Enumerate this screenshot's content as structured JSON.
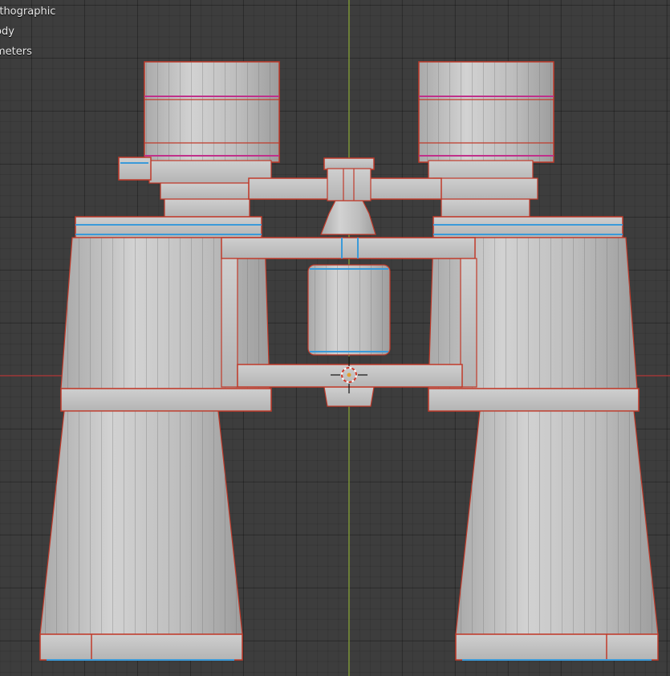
{
  "viewport": {
    "overlay_lines": [
      "rthographic",
      "ody",
      "meters"
    ],
    "colors": {
      "background": "#3d3d3d",
      "grid": "#343434",
      "axis_x": "#b63a3a",
      "axis_y": "#8fae3a",
      "mesh_fill": "#bdbdbd",
      "edge_seam": "#d23a2a",
      "edge_sharp": "#3a9ad9",
      "edge_crease": "#c0308a",
      "wire": "#444444"
    },
    "object": "binoculars-mesh",
    "cursor": "3d-cursor-icon"
  }
}
